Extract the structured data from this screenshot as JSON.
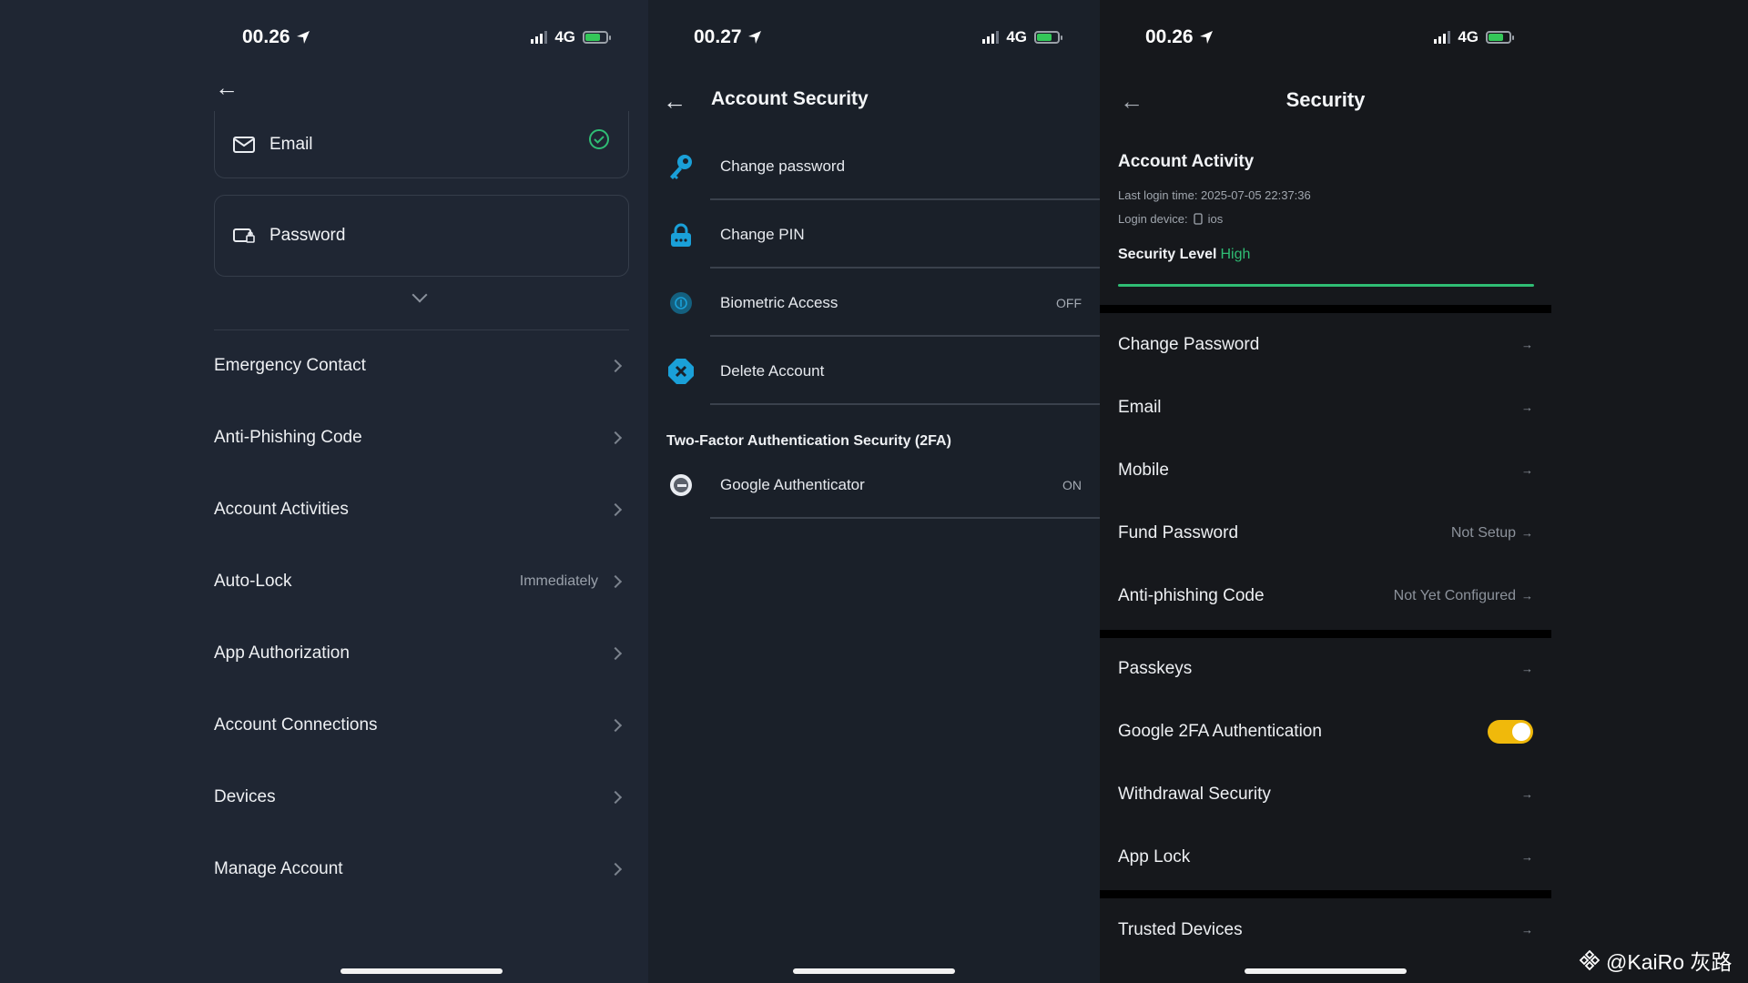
{
  "panel1": {
    "status": {
      "time": "00.26",
      "network": "4G"
    },
    "email_label": "Email",
    "password_label": "Password",
    "rows": [
      {
        "label": "Emergency Contact",
        "value": ""
      },
      {
        "label": "Anti-Phishing Code",
        "value": ""
      },
      {
        "label": "Account Activities",
        "value": ""
      },
      {
        "label": "Auto-Lock",
        "value": "Immediately"
      },
      {
        "label": "App Authorization",
        "value": ""
      },
      {
        "label": "Account Connections",
        "value": ""
      },
      {
        "label": "Devices",
        "value": ""
      },
      {
        "label": "Manage Account",
        "value": ""
      }
    ]
  },
  "panel2": {
    "status": {
      "time": "00.27",
      "network": "4G"
    },
    "title": "Account Security",
    "rows": [
      {
        "label": "Change password",
        "value": "",
        "icon": "key-icon"
      },
      {
        "label": "Change PIN",
        "value": "",
        "icon": "lock-icon"
      },
      {
        "label": "Biometric Access",
        "value": "OFF",
        "icon": "fingerprint-icon"
      },
      {
        "label": "Delete Account",
        "value": "",
        "icon": "delete-icon"
      }
    ],
    "section_title": "Two-Factor Authentication Security (2FA)",
    "twofa": {
      "label": "Google Authenticator",
      "value": "ON",
      "icon": "google-authenticator-icon"
    }
  },
  "panel3": {
    "status": {
      "time": "00.26",
      "network": "4G"
    },
    "title": "Security",
    "activity": {
      "title": "Account Activity",
      "last_login": "Last login time: 2025-07-05 22:37:36",
      "device_label": "Login device:",
      "device_value": "ios",
      "level_label": "Security Level",
      "level_value": "High"
    },
    "group1": [
      {
        "label": "Change Password",
        "value": ""
      },
      {
        "label": "Email",
        "value": ""
      },
      {
        "label": "Mobile",
        "value": ""
      },
      {
        "label": "Fund Password",
        "value": "Not Setup"
      },
      {
        "label": "Anti-phishing Code",
        "value": "Not Yet Configured"
      }
    ],
    "group2": [
      {
        "label": "Passkeys",
        "value": ""
      },
      {
        "label": "Google 2FA Authentication",
        "value": ""
      },
      {
        "label": "Withdrawal Security",
        "value": ""
      },
      {
        "label": "App Lock",
        "value": ""
      }
    ],
    "group3": [
      {
        "label": "Trusted Devices",
        "value": ""
      }
    ],
    "google_2fa_enabled": true
  },
  "watermark": "@KaiRo 灰路",
  "colors": {
    "accent_green": "#2fbd74",
    "toggle_yellow": "#f0b90b",
    "icon_blue": "#1aa0d8"
  }
}
